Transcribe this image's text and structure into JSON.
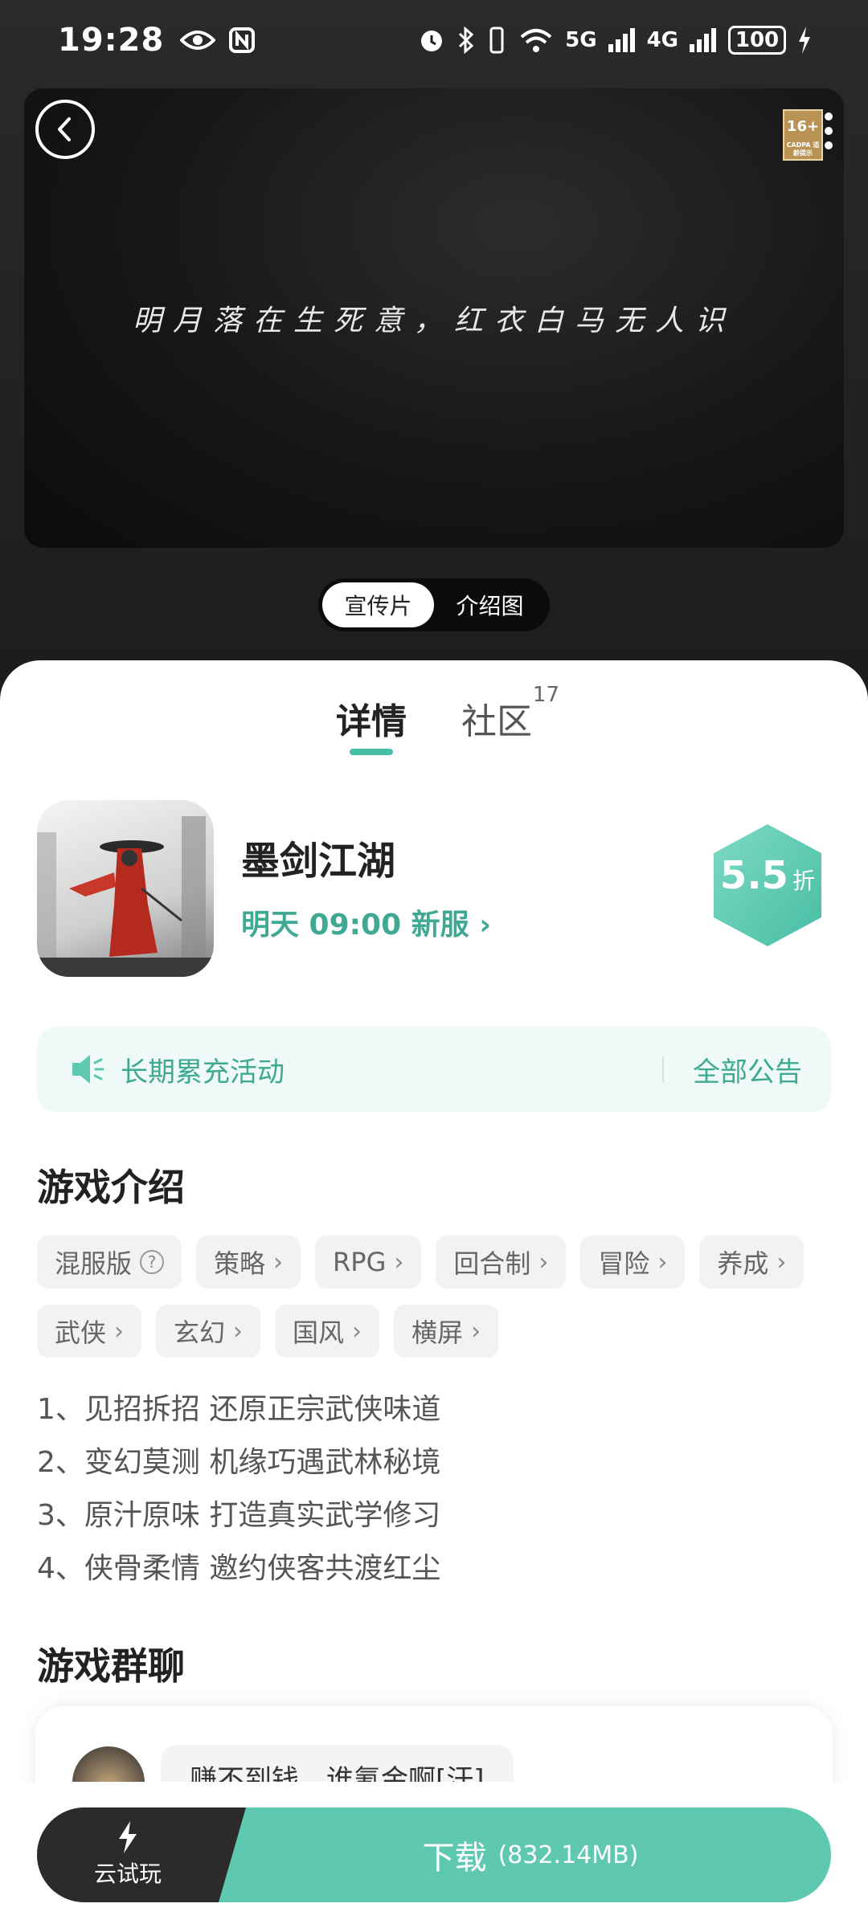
{
  "status_bar": {
    "time": "19:28",
    "signal_5g": "5G",
    "signal_4g": "4G",
    "battery": "100"
  },
  "video": {
    "caption": "明月落在生死意，红衣白马无人识",
    "age_rating": "16+",
    "age_rating_sub": "CADPA 适龄提示"
  },
  "media_switch": {
    "options": [
      "宣传片",
      "介绍图"
    ],
    "selected": "宣传片"
  },
  "tabs": {
    "details": "详情",
    "community": "社区",
    "community_count": "17"
  },
  "game": {
    "title": "墨剑江湖",
    "server_info": "明天 09:00 新服",
    "discount_value": "5.5",
    "discount_unit": "折"
  },
  "notice": {
    "text": "长期累充活动",
    "all_label": "全部公告"
  },
  "intro": {
    "title": "游戏介绍",
    "tags": [
      "混服版",
      "策略",
      "RPG",
      "回合制",
      "冒险",
      "养成",
      "武侠",
      "玄幻",
      "国风",
      "横屏"
    ],
    "description": [
      "1、见招拆招 还原正宗武侠味道",
      "2、变幻莫测 机缘巧遇武林秘境",
      "3、原汁原味 打造真实武学修习",
      "4、侠骨柔情 邀约侠客共渡红尘"
    ]
  },
  "group_chat": {
    "title": "游戏群聊",
    "message": "赚不到钱，谁氪金啊[汗]"
  },
  "bottom_bar": {
    "cloud_label": "云试玩",
    "download_label": "下载",
    "download_size": "(832.14MB)"
  },
  "colors": {
    "accent": "#45c1a6",
    "accent_text": "#3fa993",
    "download_bg": "#5fc8b1",
    "cloud_bg": "#2b2b2b"
  }
}
